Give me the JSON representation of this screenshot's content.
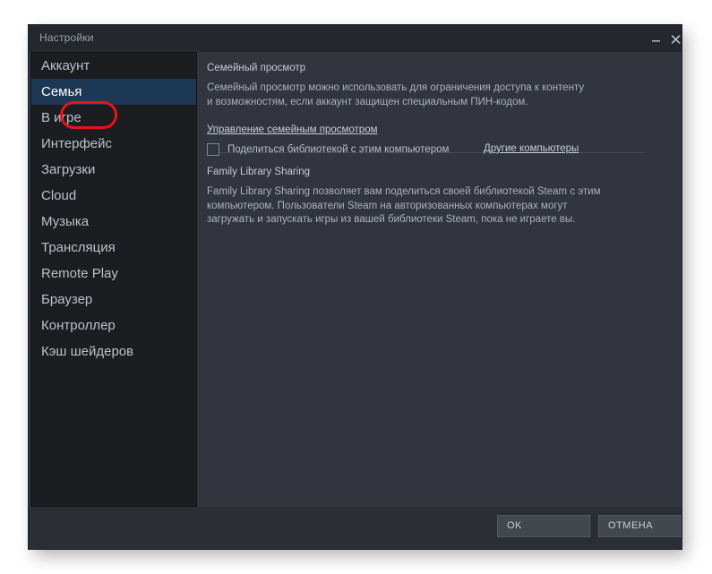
{
  "window": {
    "title": "Настройки",
    "minimize_icon": "minimize-icon",
    "close_icon": "close-icon"
  },
  "sidebar": {
    "items": [
      {
        "label": "Аккаунт",
        "selected": false
      },
      {
        "label": "Семья",
        "selected": true
      },
      {
        "label": "В игре",
        "selected": false
      },
      {
        "label": "Интерфейс",
        "selected": false
      },
      {
        "label": "Загрузки",
        "selected": false
      },
      {
        "label": "Cloud",
        "selected": false
      },
      {
        "label": "Музыка",
        "selected": false
      },
      {
        "label": "Трансляция",
        "selected": false
      },
      {
        "label": "Remote Play",
        "selected": false
      },
      {
        "label": "Браузер",
        "selected": false
      },
      {
        "label": "Контроллер",
        "selected": false
      },
      {
        "label": "Кэш шейдеров",
        "selected": false
      }
    ]
  },
  "main": {
    "family_view": {
      "heading": "Семейный просмотр",
      "description": "Семейный просмотр можно использовать для ограничения доступа к контенту и возможностям, если аккаунт защищен специальным ПИН-кодом.",
      "manage_link": "Управление семейным просмотром"
    },
    "library_sharing": {
      "heading": "Family Library Sharing",
      "description": "Family Library Sharing позволяет вам поделиться своей библиотекой Steam с этим компьютером. Пользователи Steam на авторизованных компьютерах могут загружать и запускать игры из вашей библиотеки Steam, пока не играете вы.",
      "checkbox_label": "Поделиться библиотекой с этим компьютером",
      "checkbox_checked": false,
      "other_computers_link": "Другие компьютеры"
    }
  },
  "footer": {
    "ok_label": "OK",
    "cancel_label": "ОТМЕНА"
  },
  "annotation": {
    "highlight_color": "#e8131a",
    "target": "Семья"
  },
  "colors": {
    "window_bg": "#2b2e35",
    "titlebar_bg": "#24272d",
    "sidebar_bg": "#1b1d21",
    "content_bg": "#32353d",
    "selected_item_bg": "#1d3855",
    "button_bg": "#43474f",
    "text_primary": "#c3cbd4",
    "text_secondary": "#a9b2bc"
  }
}
